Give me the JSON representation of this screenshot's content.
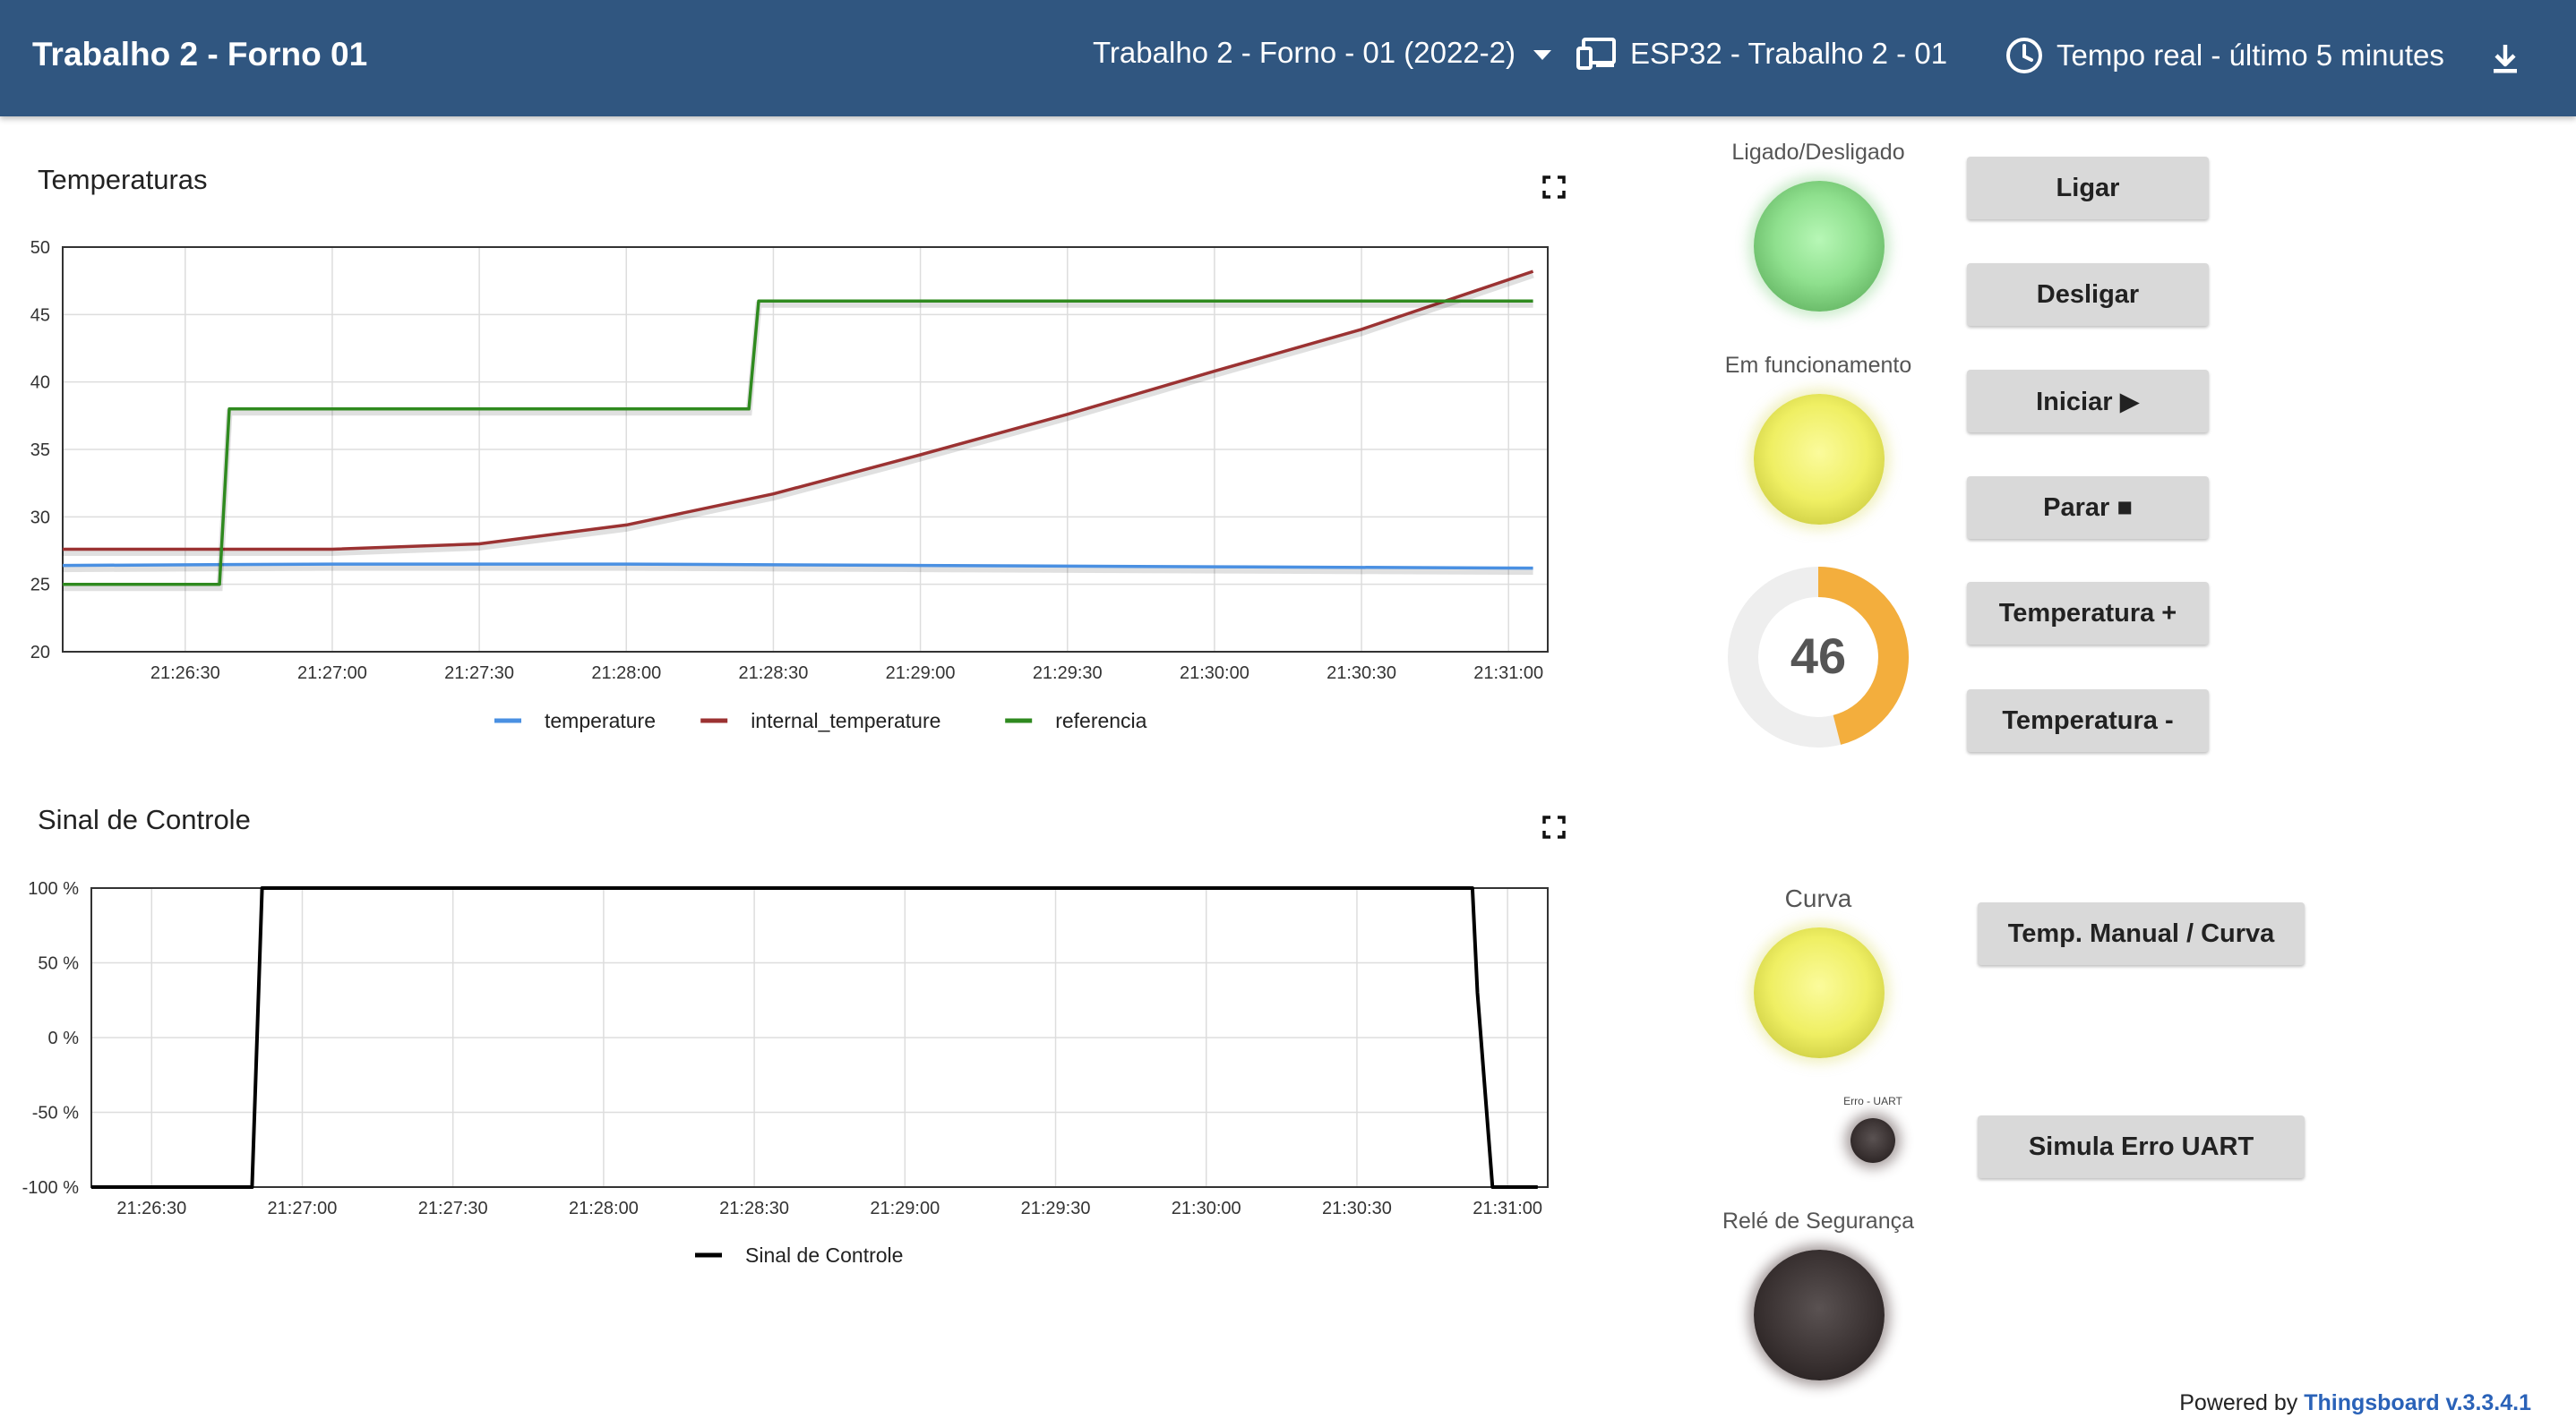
{
  "header": {
    "dashboard_title": "Trabalho 2 - Forno 01",
    "state_selector": "Trabalho 2 - Forno - 01 (2022-2)",
    "entity_selector": "ESP32 - Trabalho 2 - 01",
    "timewindow": "Tempo real - último 5 minutes",
    "icons": {
      "entity": "devices-icon",
      "time": "clock-icon",
      "download": "download-icon",
      "state": "caret-down-icon"
    }
  },
  "temp_widget": {
    "title": "Temperaturas"
  },
  "control_widget": {
    "title": "Sinal de Controle"
  },
  "leds": {
    "power": {
      "label": "Ligado/Desligado",
      "color": "#8fe08e"
    },
    "running": {
      "label": "Em funcionamento",
      "color": "#efef63"
    },
    "curve": {
      "label": "Curva",
      "color": "#efef63"
    },
    "uart": {
      "label": "Erro - UART",
      "color": "#3a3232"
    },
    "relay": {
      "label": "Relé de Segurança",
      "color": "#3a3232"
    }
  },
  "gauge": {
    "value": "46",
    "fraction": 0.46,
    "color": "#f3ae3d",
    "track_color": "#eeeeee"
  },
  "buttons": {
    "ligar": "Ligar",
    "desligar": "Desligar",
    "iniciar": "Iniciar ▶",
    "parar": "Parar ■",
    "temp_plus": "Temperatura +",
    "temp_minus": "Temperatura -",
    "manual_curve": "Temp. Manual / Curva",
    "simula_uart": "Simula Erro UART"
  },
  "footer": {
    "prefix": "Powered by",
    "link": "Thingsboard v.3.3.4.1"
  },
  "chart_data": [
    {
      "type": "line",
      "title": "Temperaturas",
      "ylim": [
        20,
        50
      ],
      "yticks": [
        "50",
        "45",
        "40",
        "35",
        "30",
        "25",
        "20"
      ],
      "xlim": [
        "21:26:05",
        "21:31:08"
      ],
      "xticks": [
        "21:26:30",
        "21:27:00",
        "21:27:30",
        "21:28:00",
        "21:28:30",
        "21:29:00",
        "21:29:30",
        "21:30:00",
        "21:30:30",
        "21:31:00"
      ],
      "grid": true,
      "legend": "bottom",
      "series": [
        {
          "name": "temperature",
          "color": "#4a90e2",
          "x": [
            "21:26:05",
            "21:27:00",
            "21:28:00",
            "21:29:00",
            "21:30:00",
            "21:31:05"
          ],
          "y": [
            26.4,
            26.5,
            26.5,
            26.4,
            26.3,
            26.2
          ]
        },
        {
          "name": "internal_temperature",
          "color": "#9b3232",
          "x": [
            "21:26:05",
            "21:27:00",
            "21:27:30",
            "21:28:00",
            "21:28:30",
            "21:29:00",
            "21:29:30",
            "21:30:00",
            "21:30:30",
            "21:31:05"
          ],
          "y": [
            27.6,
            27.6,
            28.0,
            29.4,
            31.7,
            34.6,
            37.6,
            40.8,
            43.9,
            48.2
          ]
        },
        {
          "name": "referencia",
          "color": "#2f8a1f",
          "x": [
            "21:26:05",
            "21:26:37",
            "21:26:39",
            "21:28:25",
            "21:28:27",
            "21:31:05"
          ],
          "y": [
            25,
            25,
            38,
            38,
            46,
            46
          ]
        }
      ]
    },
    {
      "type": "line",
      "title": "Sinal de Controle",
      "ylim": [
        -100,
        100
      ],
      "yticks": [
        "100 %",
        "50 %",
        "0 %",
        "-50 %",
        "-100 %"
      ],
      "xlim": [
        "21:26:18",
        "21:31:08"
      ],
      "xticks": [
        "21:26:30",
        "21:27:00",
        "21:27:30",
        "21:28:00",
        "21:28:30",
        "21:29:00",
        "21:29:30",
        "21:30:00",
        "21:30:30",
        "21:31:00"
      ],
      "grid": true,
      "legend": "bottom",
      "series": [
        {
          "name": "Sinal de Controle",
          "color": "#000000",
          "x": [
            "21:26:18",
            "21:26:50",
            "21:26:52",
            "21:30:53",
            "21:30:54",
            "21:30:57",
            "21:31:06"
          ],
          "y": [
            -100,
            -100,
            100,
            100,
            30,
            -100,
            -100
          ]
        }
      ]
    }
  ]
}
